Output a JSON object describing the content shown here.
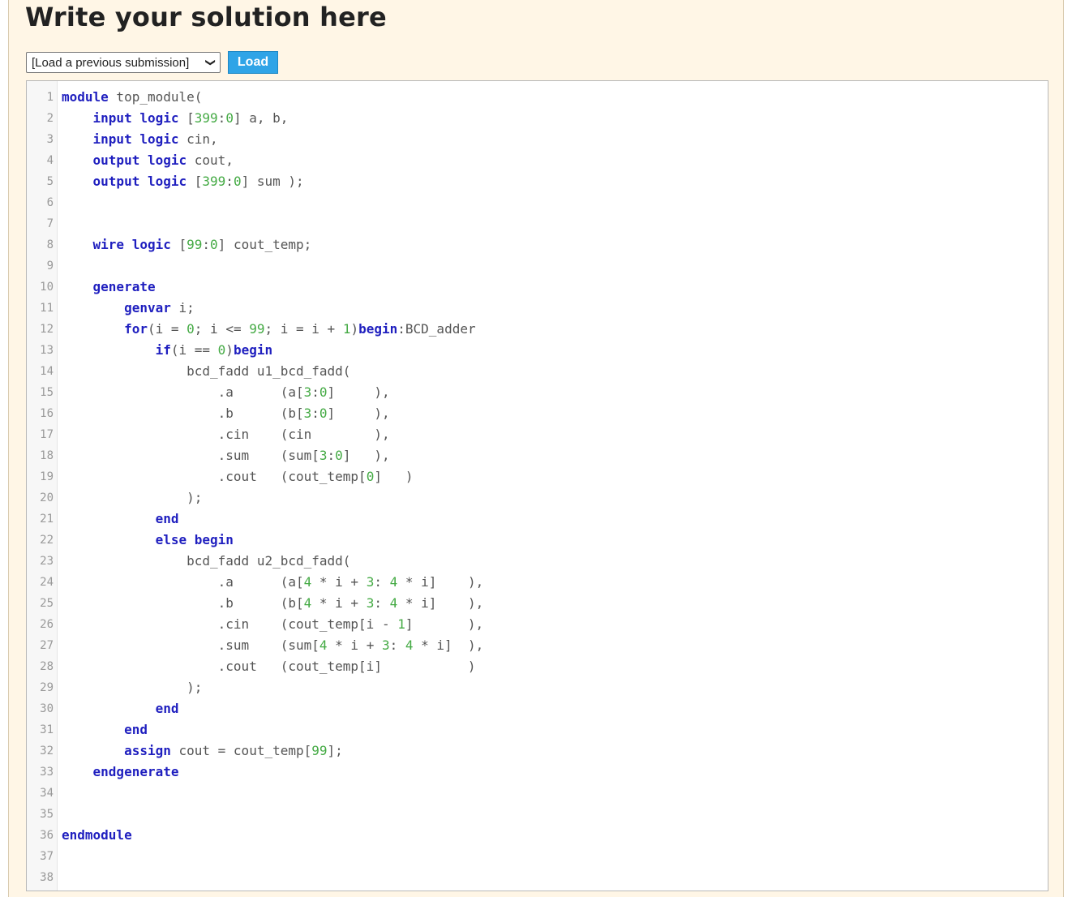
{
  "heading": "Write your solution here",
  "submission_select": {
    "selected": "[Load a previous submission]"
  },
  "load_button": "Load",
  "colors": {
    "panel_bg": "#fff6e6",
    "keyword": "#1f1fbf",
    "number": "#44aa44",
    "load_button": "#2fa4e7"
  },
  "code_lines": [
    [
      [
        "kw",
        "module"
      ],
      [
        "t",
        " top_module("
      ]
    ],
    [
      [
        "t",
        "    "
      ],
      [
        "kw",
        "input logic"
      ],
      [
        "t",
        " ["
      ],
      [
        "num",
        "399"
      ],
      [
        "t",
        ":"
      ],
      [
        "num",
        "0"
      ],
      [
        "t",
        "] a, b,"
      ]
    ],
    [
      [
        "t",
        "    "
      ],
      [
        "kw",
        "input logic"
      ],
      [
        "t",
        " cin,"
      ]
    ],
    [
      [
        "t",
        "    "
      ],
      [
        "kw",
        "output logic"
      ],
      [
        "t",
        " cout,"
      ]
    ],
    [
      [
        "t",
        "    "
      ],
      [
        "kw",
        "output logic"
      ],
      [
        "t",
        " ["
      ],
      [
        "num",
        "399"
      ],
      [
        "t",
        ":"
      ],
      [
        "num",
        "0"
      ],
      [
        "t",
        "] sum );"
      ]
    ],
    [],
    [],
    [
      [
        "t",
        "    "
      ],
      [
        "kw",
        "wire logic"
      ],
      [
        "t",
        " ["
      ],
      [
        "num",
        "99"
      ],
      [
        "t",
        ":"
      ],
      [
        "num",
        "0"
      ],
      [
        "t",
        "] cout_temp;"
      ]
    ],
    [],
    [
      [
        "t",
        "    "
      ],
      [
        "kw",
        "generate"
      ]
    ],
    [
      [
        "t",
        "        "
      ],
      [
        "kw",
        "genvar"
      ],
      [
        "t",
        " i;"
      ]
    ],
    [
      [
        "t",
        "        "
      ],
      [
        "kw",
        "for"
      ],
      [
        "t",
        "(i = "
      ],
      [
        "num",
        "0"
      ],
      [
        "t",
        "; i <= "
      ],
      [
        "num",
        "99"
      ],
      [
        "t",
        "; i = i + "
      ],
      [
        "num",
        "1"
      ],
      [
        "t",
        ")"
      ],
      [
        "kw",
        "begin"
      ],
      [
        "t",
        ":BCD_adder"
      ]
    ],
    [
      [
        "t",
        "            "
      ],
      [
        "kw",
        "if"
      ],
      [
        "t",
        "(i == "
      ],
      [
        "num",
        "0"
      ],
      [
        "t",
        ")"
      ],
      [
        "kw",
        "begin"
      ]
    ],
    [
      [
        "t",
        "                bcd_fadd u1_bcd_fadd("
      ]
    ],
    [
      [
        "t",
        "                    .a      (a["
      ],
      [
        "num",
        "3"
      ],
      [
        "t",
        ":"
      ],
      [
        "num",
        "0"
      ],
      [
        "t",
        "]     ),"
      ]
    ],
    [
      [
        "t",
        "                    .b      (b["
      ],
      [
        "num",
        "3"
      ],
      [
        "t",
        ":"
      ],
      [
        "num",
        "0"
      ],
      [
        "t",
        "]     ),"
      ]
    ],
    [
      [
        "t",
        "                    .cin    (cin        ),"
      ]
    ],
    [
      [
        "t",
        "                    .sum    (sum["
      ],
      [
        "num",
        "3"
      ],
      [
        "t",
        ":"
      ],
      [
        "num",
        "0"
      ],
      [
        "t",
        "]   ),"
      ]
    ],
    [
      [
        "t",
        "                    .cout   (cout_temp["
      ],
      [
        "num",
        "0"
      ],
      [
        "t",
        "]   )"
      ]
    ],
    [
      [
        "t",
        "                );"
      ]
    ],
    [
      [
        "t",
        "            "
      ],
      [
        "kw",
        "end"
      ]
    ],
    [
      [
        "t",
        "            "
      ],
      [
        "kw",
        "else begin"
      ]
    ],
    [
      [
        "t",
        "                bcd_fadd u2_bcd_fadd("
      ]
    ],
    [
      [
        "t",
        "                    .a      (a["
      ],
      [
        "num",
        "4"
      ],
      [
        "t",
        " * i + "
      ],
      [
        "num",
        "3"
      ],
      [
        "t",
        ": "
      ],
      [
        "num",
        "4"
      ],
      [
        "t",
        " * i]    ),"
      ]
    ],
    [
      [
        "t",
        "                    .b      (b["
      ],
      [
        "num",
        "4"
      ],
      [
        "t",
        " * i + "
      ],
      [
        "num",
        "3"
      ],
      [
        "t",
        ": "
      ],
      [
        "num",
        "4"
      ],
      [
        "t",
        " * i]    ),"
      ]
    ],
    [
      [
        "t",
        "                    .cin    (cout_temp[i - "
      ],
      [
        "num",
        "1"
      ],
      [
        "t",
        "]       ),"
      ]
    ],
    [
      [
        "t",
        "                    .sum    (sum["
      ],
      [
        "num",
        "4"
      ],
      [
        "t",
        " * i + "
      ],
      [
        "num",
        "3"
      ],
      [
        "t",
        ": "
      ],
      [
        "num",
        "4"
      ],
      [
        "t",
        " * i]  ),"
      ]
    ],
    [
      [
        "t",
        "                    .cout   (cout_temp[i]           )"
      ]
    ],
    [
      [
        "t",
        "                );"
      ]
    ],
    [
      [
        "t",
        "            "
      ],
      [
        "kw",
        "end"
      ]
    ],
    [
      [
        "t",
        "        "
      ],
      [
        "kw",
        "end"
      ]
    ],
    [
      [
        "t",
        "        "
      ],
      [
        "kw",
        "assign"
      ],
      [
        "t",
        " cout = cout_temp["
      ],
      [
        "num",
        "99"
      ],
      [
        "t",
        "];"
      ]
    ],
    [
      [
        "t",
        "    "
      ],
      [
        "kw",
        "endgenerate"
      ]
    ],
    [],
    [],
    [
      [
        "kw",
        "endmodule"
      ]
    ],
    [],
    []
  ]
}
